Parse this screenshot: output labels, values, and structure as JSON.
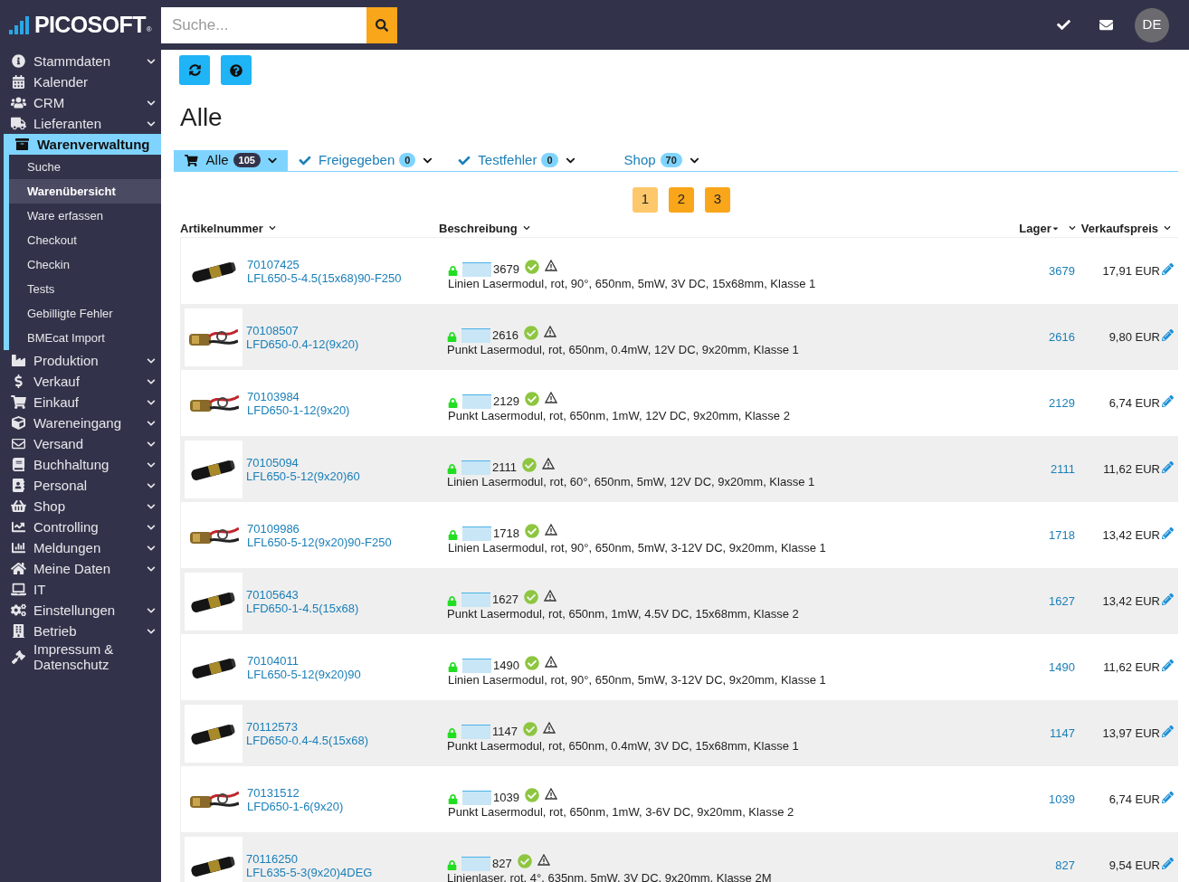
{
  "header": {
    "logo": "PICOSOFT",
    "logo_mark": "®",
    "search": {
      "placeholder": "Suche..."
    },
    "avatar": "DE"
  },
  "sidebar": {
    "items": [
      {
        "label": "Stammdaten",
        "expandable": true,
        "selected": false
      },
      {
        "label": "Kalender",
        "expandable": false,
        "selected": false
      },
      {
        "label": "CRM",
        "expandable": true,
        "selected": false
      },
      {
        "label": "Lieferanten",
        "expandable": true,
        "selected": false
      },
      {
        "label": "Warenverwaltung",
        "expandable": false,
        "selected": true,
        "children": [
          {
            "label": "Suche",
            "selected": false
          },
          {
            "label": "Warenübersicht",
            "selected": true
          },
          {
            "label": "Ware erfassen",
            "selected": false
          },
          {
            "label": "Checkout",
            "selected": false
          },
          {
            "label": "Checkin",
            "selected": false
          },
          {
            "label": "Tests",
            "selected": false
          },
          {
            "label": "Gebilligte Fehler",
            "selected": false
          },
          {
            "label": "BMEcat Import",
            "selected": false
          }
        ]
      },
      {
        "label": "Produktion",
        "expandable": true,
        "selected": false
      },
      {
        "label": "Verkauf",
        "expandable": true,
        "selected": false
      },
      {
        "label": "Einkauf",
        "expandable": true,
        "selected": false
      },
      {
        "label": "Wareneingang",
        "expandable": true,
        "selected": false
      },
      {
        "label": "Versand",
        "expandable": true,
        "selected": false
      },
      {
        "label": "Buchhaltung",
        "expandable": true,
        "selected": false
      },
      {
        "label": "Personal",
        "expandable": true,
        "selected": false
      },
      {
        "label": "Shop",
        "expandable": true,
        "selected": false
      },
      {
        "label": "Controlling",
        "expandable": true,
        "selected": false
      },
      {
        "label": "Meldungen",
        "expandable": true,
        "selected": false
      },
      {
        "label": "Meine Daten",
        "expandable": true,
        "selected": false
      },
      {
        "label": "IT",
        "expandable": false,
        "selected": false
      },
      {
        "label": "Einstellungen",
        "expandable": true,
        "selected": false
      },
      {
        "label": "Betrieb",
        "expandable": true,
        "selected": false
      },
      {
        "label": "Impressum & Datenschutz",
        "expandable": false,
        "selected": false
      }
    ]
  },
  "page_title": "Alle",
  "tabs": [
    {
      "label": "Alle",
      "count": "105",
      "selected": true
    },
    {
      "label": "Freigegeben",
      "count": "0",
      "selected": false
    },
    {
      "label": "Testfehler",
      "count": "0",
      "selected": false
    },
    {
      "label": "Shop",
      "count": "70",
      "selected": false
    }
  ],
  "pagination": [
    {
      "label": "1",
      "selected": true
    },
    {
      "label": "2",
      "selected": false
    },
    {
      "label": "3",
      "selected": false
    }
  ],
  "table": {
    "columns": [
      "Artikelnummer",
      "Beschreibung",
      "Lager",
      "Verkaufspreis"
    ],
    "rows": [
      {
        "article_no": "70107425",
        "model": "LFL650-5-4.5(15x68)90-F250",
        "stock_bar": "3679",
        "description": "Linien Lasermodul, rot, 90°, 650nm, 5mW, 3V DC, 15x68mm, Klasse 1",
        "stock": "3679",
        "price": "17,91 EUR"
      },
      {
        "article_no": "70108507",
        "model": "LFD650-0.4-12(9x20)",
        "stock_bar": "2616",
        "description": "Punkt Lasermodul, rot, 650nm, 0.4mW, 12V DC, 9x20mm, Klasse 1",
        "stock": "2616",
        "price": "9,80 EUR"
      },
      {
        "article_no": "70103984",
        "model": "LFD650-1-12(9x20)",
        "stock_bar": "2129",
        "description": "Punkt Lasermodul, rot, 650nm, 1mW, 12V DC, 9x20mm, Klasse 2",
        "stock": "2129",
        "price": "6,74 EUR"
      },
      {
        "article_no": "70105094",
        "model": "LFL650-5-12(9x20)60",
        "stock_bar": "2111",
        "description": "Linien Lasermodul, rot, 60°, 650nm, 5mW, 12V DC, 9x20mm, Klasse 1",
        "stock": "2111",
        "price": "11,62 EUR"
      },
      {
        "article_no": "70109986",
        "model": "LFL650-5-12(9x20)90-F250",
        "stock_bar": "1718",
        "description": "Linien Lasermodul, rot, 90°, 650nm, 5mW, 3-12V DC, 9x20mm, Klasse 1",
        "stock": "1718",
        "price": "13,42 EUR"
      },
      {
        "article_no": "70105643",
        "model": "LFD650-1-4.5(15x68)",
        "stock_bar": "1627",
        "description": "Punkt Lasermodul, rot, 650nm, 1mW, 4.5V DC, 15x68mm, Klasse 2",
        "stock": "1627",
        "price": "13,42 EUR"
      },
      {
        "article_no": "70104011",
        "model": "LFL650-5-12(9x20)90",
        "stock_bar": "1490",
        "description": "Linien Lasermodul, rot, 90°, 650nm, 5mW, 3-12V DC, 9x20mm, Klasse 1",
        "stock": "1490",
        "price": "11,62 EUR"
      },
      {
        "article_no": "70112573",
        "model": "LFD650-0.4-4.5(15x68)",
        "stock_bar": "1147",
        "description": "Punkt Lasermodul, rot, 650nm, 0.4mW, 3V DC, 15x68mm, Klasse 1",
        "stock": "1147",
        "price": "13,97 EUR"
      },
      {
        "article_no": "70131512",
        "model": "LFD650-1-6(9x20)",
        "stock_bar": "1039",
        "description": "Punkt Lasermodul, rot, 650nm, 1mW, 3-6V DC, 9x20mm, Klasse 2",
        "stock": "1039",
        "price": "6,74 EUR"
      },
      {
        "article_no": "70116250",
        "model": "LFL635-5-3(9x20)4DEG",
        "stock_bar": "827",
        "description": "Linienlaser, rot, 4°, 635nm, 5mW, 3V DC, 9x20mm, Klasse 2M",
        "stock": "827",
        "price": "9,54 EUR"
      }
    ]
  }
}
